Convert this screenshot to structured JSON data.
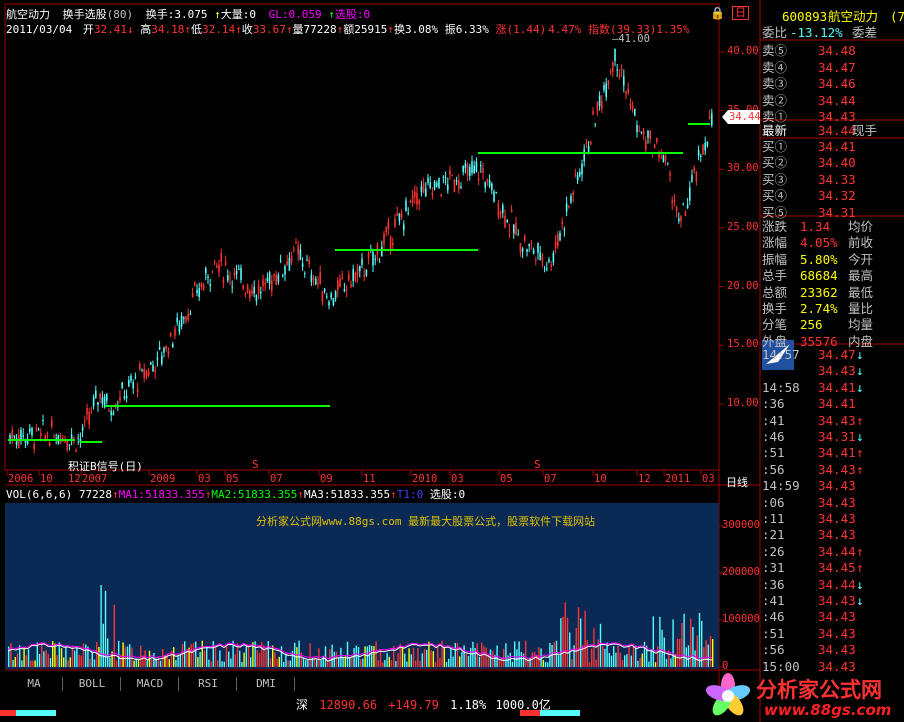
{
  "header": {
    "stock_name": "航空动力",
    "indicator_name": "换手选股",
    "indicator_param": "(80)",
    "hs_label": "换手:",
    "hs_value": "3.075",
    "dl_label": "大量:",
    "dl_value": "0",
    "gl_label": "GL:",
    "gl_value": "0.059",
    "xg_label": "选股:",
    "xg_value": "0",
    "lock_icon": "lock-icon",
    "close_label": "日"
  },
  "quote_line": {
    "date": "2011/03/04",
    "open_label": "开",
    "open": "32.41",
    "high_label": "高",
    "high": "34.18",
    "low_label": "低",
    "low": "32.14",
    "close_label": "收",
    "close": "33.67",
    "vol_label": "量",
    "vol": "77228",
    "amt_label": "额",
    "amt": "25915",
    "turn_label": "换",
    "turn": "3.08%",
    "amp_label": "振",
    "amp": "6.33%",
    "chg_label": "涨",
    "chg": "(1.44)",
    "chg_pct": "4.47%",
    "idx_label": "指数",
    "idx": "(39.33)",
    "idx_pct": "1.35%"
  },
  "price_axis": [
    "40.00",
    "35.00",
    "30.00",
    "25.00",
    "20.00",
    "15.00",
    "10.00"
  ],
  "current_price_tag": "34.44",
  "high_marker": "41.00",
  "signal_label": "积证B信号(日)",
  "s_marker": "S",
  "date_axis": [
    "2006",
    "10",
    "2007",
    "2009",
    "03",
    "05",
    "07",
    "09",
    "11",
    "2010",
    "03",
    "05",
    "07",
    "10",
    "12",
    "2011",
    "03"
  ],
  "date_axis_sub": "12",
  "period_label": "日线",
  "vol_header": {
    "vol": "VOL(6,6,6)",
    "vol_v": "77228",
    "ma1": "MA1:51833.355",
    "ma2": "MA2:51833.355",
    "ma3": "MA3:51833.355",
    "t1": "T1:0",
    "xg": "选股:0"
  },
  "watermark": "分析家公式网www.88gs.com 最新最大股票公式，股票软件下载网站",
  "vol_axis": [
    "300000",
    "200000",
    "100000",
    "0"
  ],
  "bottom_tabs": [
    "MA",
    "BOLL",
    "MACD",
    "RSI",
    "DMI"
  ],
  "status": {
    "market": "深",
    "index": "12890.66",
    "change": "+149.79",
    "pct": "1.18%",
    "amount": "1000.0亿"
  },
  "right_panel": {
    "code": "600893",
    "name": "航空动力",
    "name_tail": "(7",
    "webi_label": "委比",
    "webi_value": "-13.12%",
    "wecha_label": "委差",
    "sell": [
      {
        "label": "卖⑤",
        "price": "34.48"
      },
      {
        "label": "卖④",
        "price": "34.47"
      },
      {
        "label": "卖③",
        "price": "34.46"
      },
      {
        "label": "卖②",
        "price": "34.44"
      },
      {
        "label": "卖①",
        "price": "34.43"
      }
    ],
    "latest_label": "最新",
    "latest_price": "34.44",
    "xianshou_label": "现手",
    "buy": [
      {
        "label": "买①",
        "price": "34.41"
      },
      {
        "label": "买②",
        "price": "34.40"
      },
      {
        "label": "买③",
        "price": "34.33"
      },
      {
        "label": "买④",
        "price": "34.32"
      },
      {
        "label": "买⑤",
        "price": "34.31"
      }
    ],
    "stats": [
      {
        "l": "涨跌",
        "v": "1.34",
        "r": "均价"
      },
      {
        "l": "涨幅",
        "v": "4.05%",
        "r": "前收"
      },
      {
        "l": "振幅",
        "v": "5.80%",
        "r": "今开"
      },
      {
        "l": "总手",
        "v": "68684",
        "r": "最高"
      },
      {
        "l": "总额",
        "v": "23362",
        "r": "最低"
      },
      {
        "l": "换手",
        "v": "2.74%",
        "r": "量比"
      },
      {
        "l": "分笔",
        "v": "256",
        "r": "均量"
      },
      {
        "l": "外盘",
        "v": "35576",
        "r": "内盘"
      }
    ],
    "ticks": [
      {
        "t": "14:57",
        "p": "34.47",
        "d": "down",
        "c": "r"
      },
      {
        "t": "",
        "p": "34.43",
        "d": "down",
        "c": "r"
      },
      {
        "t": "14:58",
        "p": "34.41",
        "d": "down",
        "c": "r"
      },
      {
        "t": ":36",
        "p": "34.41",
        "d": "",
        "c": "r"
      },
      {
        "t": ":41",
        "p": "34.43",
        "d": "up",
        "c": "r"
      },
      {
        "t": ":46",
        "p": "34.31",
        "d": "down",
        "c": "r"
      },
      {
        "t": ":51",
        "p": "34.41",
        "d": "up",
        "c": "r"
      },
      {
        "t": ":56",
        "p": "34.43",
        "d": "up",
        "c": "r"
      },
      {
        "t": "14:59",
        "p": "34.43",
        "d": "",
        "c": "r"
      },
      {
        "t": ":06",
        "p": "34.43",
        "d": "",
        "c": "r"
      },
      {
        "t": ":11",
        "p": "34.43",
        "d": "",
        "c": "r"
      },
      {
        "t": ":21",
        "p": "34.43",
        "d": "",
        "c": "r"
      },
      {
        "t": ":26",
        "p": "34.44",
        "d": "up",
        "c": "r"
      },
      {
        "t": ":31",
        "p": "34.45",
        "d": "up",
        "c": "r"
      },
      {
        "t": ":36",
        "p": "34.44",
        "d": "down",
        "c": "r"
      },
      {
        "t": ":41",
        "p": "34.43",
        "d": "down",
        "c": "r"
      },
      {
        "t": ":46",
        "p": "34.43",
        "d": "",
        "c": "r"
      },
      {
        "t": ":51",
        "p": "34.43",
        "d": "",
        "c": "r"
      },
      {
        "t": ":56",
        "p": "34.43",
        "d": "",
        "c": "r"
      },
      {
        "t": "15:00",
        "p": "34.43",
        "d": "",
        "c": "r"
      }
    ]
  },
  "logo_text": "分析家公式网",
  "logo_url": "www.88gs.com",
  "colors": {
    "up": "#ff3232",
    "down": "#54fcfc",
    "green": "#00ff00",
    "yellow": "#ffff00",
    "magenta": "#ff00ff"
  }
}
